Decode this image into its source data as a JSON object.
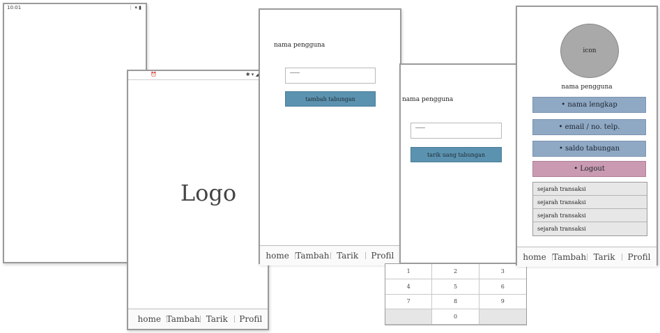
{
  "screen_blank": {
    "status_time": "10:01",
    "status_right": "⋮ ▾ ▮"
  },
  "screen_splash": {
    "status_left_icon": "alarm-icon",
    "status_right_icons": "✱ ▾ ◢ ▮",
    "logo_text": "Logo",
    "nav": [
      "home",
      "Tambah",
      "Tarik",
      "Profil"
    ]
  },
  "screen_tambah": {
    "username_label": "nama pengguna",
    "button_label": "tambah tabungan",
    "nav": [
      "home",
      "Tambah",
      "Tarik",
      "Profil"
    ]
  },
  "screen_tarik": {
    "username_label": "nama pengguna",
    "button_label": "tarik uang tabungan",
    "keypad": [
      "1",
      "2",
      "3",
      "4",
      "5",
      "6",
      "7",
      "8",
      "9",
      "",
      "0",
      ""
    ]
  },
  "screen_profil": {
    "icon_label": "icon",
    "username_label": "nama pengguna",
    "fields": [
      "• nama lengkap",
      "• email / no. telp.",
      "• saldo tabungan"
    ],
    "logout_label": "• Logout",
    "history": [
      "sejarah transaksi",
      "sejarah transaksi",
      "sejarah transaksi",
      "sejarah transaksi"
    ],
    "nav": [
      "home",
      "Tambah",
      "Tarik",
      "Profil"
    ]
  },
  "colors": {
    "button_blue": "#5b92b0",
    "field_blue": "#8fa8c4",
    "logout_pink": "#c99ab1",
    "avatar_gray": "#a9a9a9"
  }
}
